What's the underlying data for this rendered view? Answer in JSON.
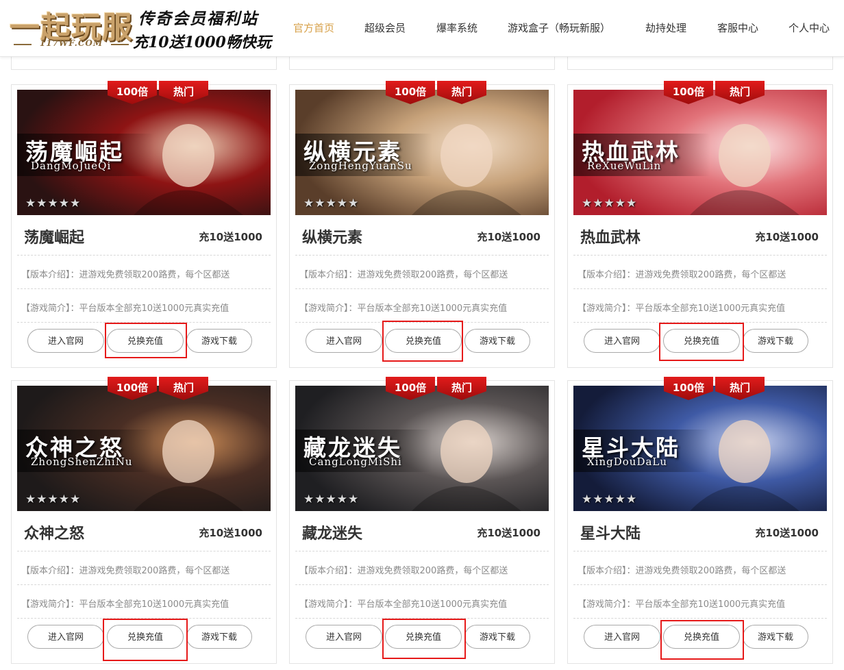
{
  "header": {
    "logo_title": "一起玩服",
    "logo_site": "117WF.COM",
    "slogan_line1": "传奇会员福利站",
    "slogan_line2": "充10送1000畅快玩",
    "nav": [
      {
        "label": "官方首页",
        "active": true
      },
      {
        "label": "超级会员",
        "active": false
      },
      {
        "label": "爆率系统",
        "active": false
      },
      {
        "label": "游戏盒子（畅玩新服）",
        "active": false
      },
      {
        "label": "劫持处理",
        "active": false
      },
      {
        "label": "客服中心",
        "active": false
      },
      {
        "label": "个人中心",
        "active": false
      }
    ]
  },
  "cards": [
    {
      "name": "荡魔崛起",
      "banner_title": "荡魔崛起",
      "banner_pinyin": "DangMoJueQi",
      "tag_rate": "100倍",
      "tag_hot": "热门",
      "stars": "★★★★★",
      "price": "充10送1000",
      "intro": "【版本介绍】：进游戏免费领取200路费，每个区都送",
      "desc": "【游戏简介】：平台版本全部充10送1000元真实充值",
      "btn_site": "进入官网",
      "btn_recharge": "兑换充值",
      "btn_download": "游戏下载",
      "accent": "#9c1b1b"
    },
    {
      "name": "纵横元素",
      "banner_title": "纵横元素",
      "banner_pinyin": "ZongHengYuanSu",
      "tag_rate": "100倍",
      "tag_hot": "热门",
      "stars": "★★★★★",
      "price": "充10送1000",
      "intro": "【版本介绍】：进游戏免费领取200路费，每个区都送",
      "desc": "【游戏简介】：平台版本全部充10送1000元真实充值",
      "btn_site": "进入官网",
      "btn_recharge": "兑换充值",
      "btn_download": "游戏下载",
      "accent": "#b89469"
    },
    {
      "name": "热血武林",
      "banner_title": "热血武林",
      "banner_pinyin": "ReXueWuLin",
      "tag_rate": "100倍",
      "tag_hot": "热门",
      "stars": "★★★★★",
      "price": "充10送1000",
      "intro": "【版本介绍】：进游戏免费领取200路费，每个区都送",
      "desc": "【游戏简介】：平台版本全部充10送1000元真实充值",
      "btn_site": "进入官网",
      "btn_recharge": "兑换充值",
      "btn_download": "游戏下载",
      "accent": "#d94f56"
    },
    {
      "name": "众神之怒",
      "banner_title": "众神之怒",
      "banner_pinyin": "ZhongShenZhiNu",
      "tag_rate": "100倍",
      "tag_hot": "热门",
      "stars": "★★★★★",
      "price": "充10送1000",
      "intro": "【版本介绍】：进游戏免费领取200路费，每个区都送",
      "desc": "【游戏简介】：平台版本全部充10送1000元真实充值",
      "btn_site": "进入官网",
      "btn_recharge": "兑换充值",
      "btn_download": "游戏下载",
      "accent": "#3a2d2a"
    },
    {
      "name": "藏龙迷失",
      "banner_title": "藏龙迷失",
      "banner_pinyin": "CangLongMiShi",
      "tag_rate": "100倍",
      "tag_hot": "热门",
      "stars": "★★★★★",
      "price": "充10送1000",
      "intro": "【版本介绍】：进游戏免费领取200路费，每个区都送",
      "desc": "【游戏简介】：平台版本全部充10送1000元真实充值",
      "btn_site": "进入官网",
      "btn_recharge": "兑换充值",
      "btn_download": "游戏下载",
      "accent": "#4a4646"
    },
    {
      "name": "星斗大陆",
      "banner_title": "星斗大陆",
      "banner_pinyin": "XingDouDaLu",
      "tag_rate": "100倍",
      "tag_hot": "热门",
      "stars": "★★★★★",
      "price": "充10送1000",
      "intro": "【版本介绍】：进游戏免费领取200路费，每个区都送",
      "desc": "【游戏简介】：平台版本全部充10送1000元真实充值",
      "btn_site": "进入官网",
      "btn_recharge": "兑换充值",
      "btn_download": "游戏下载",
      "accent": "#3d4f8a"
    }
  ],
  "colors": {
    "nav_active": "#d7a14a",
    "tag_red": "#d01515",
    "highlight_box": "#e61919"
  }
}
